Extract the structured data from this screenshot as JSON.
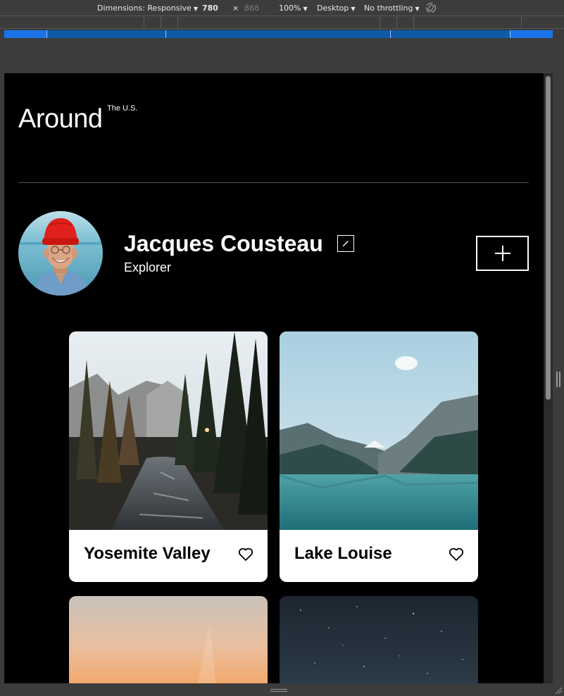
{
  "devtools": {
    "dimensions_label": "Dimensions: Responsive",
    "width_value": "780",
    "times_sign": "×",
    "height_placeholder": "868",
    "zoom": "100%",
    "device_type": "Desktop",
    "throttling": "No throttling",
    "rotate_icon": "rotate-icon",
    "media_query_color": "#1a73e8",
    "media_query_dark_color": "#0d5aa7"
  },
  "page": {
    "logo_main": "Around",
    "logo_sup": "The U.S.",
    "profile": {
      "name": "Jacques Cousteau",
      "job": "Explorer",
      "avatar_icon": "avatar-photo",
      "edit_icon": "pencil-icon",
      "add_icon": "plus-icon"
    },
    "cards": [
      {
        "title": "Yosemite Valley",
        "like_icon": "heart-icon"
      },
      {
        "title": "Lake Louise",
        "like_icon": "heart-icon"
      }
    ],
    "colors": {
      "background": "#000000",
      "card": "#ffffff",
      "text_on_dark": "#ffffff",
      "text_on_card": "#000000"
    }
  }
}
